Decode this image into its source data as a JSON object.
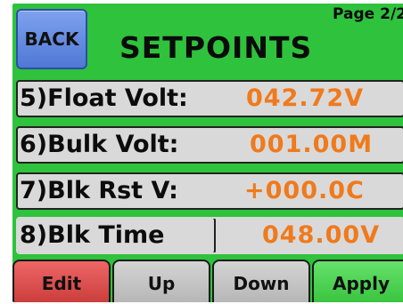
{
  "header": {
    "back_label": "BACK",
    "title": "SETPOINTS",
    "page_indicator": "Page 2/2"
  },
  "rows": [
    {
      "label": "5)Float Volt:",
      "value": "042.72V"
    },
    {
      "label": "6)Bulk Volt:",
      "value": "001.00M"
    },
    {
      "label": "7)Blk Rst V:",
      "value": "+000.0C"
    },
    {
      "label": "8)Blk Time",
      "value": "048.00V"
    }
  ],
  "buttons": {
    "edit": "Edit",
    "up": "Up",
    "down": "Down",
    "apply": "Apply"
  },
  "colors": {
    "background_green": "#2fc23c",
    "value_orange": "#ef7a1d",
    "back_blue": "#5f86df",
    "edit_red": "#d94848",
    "apply_green": "#47cf4c",
    "row_gray": "#d9d9d9"
  }
}
